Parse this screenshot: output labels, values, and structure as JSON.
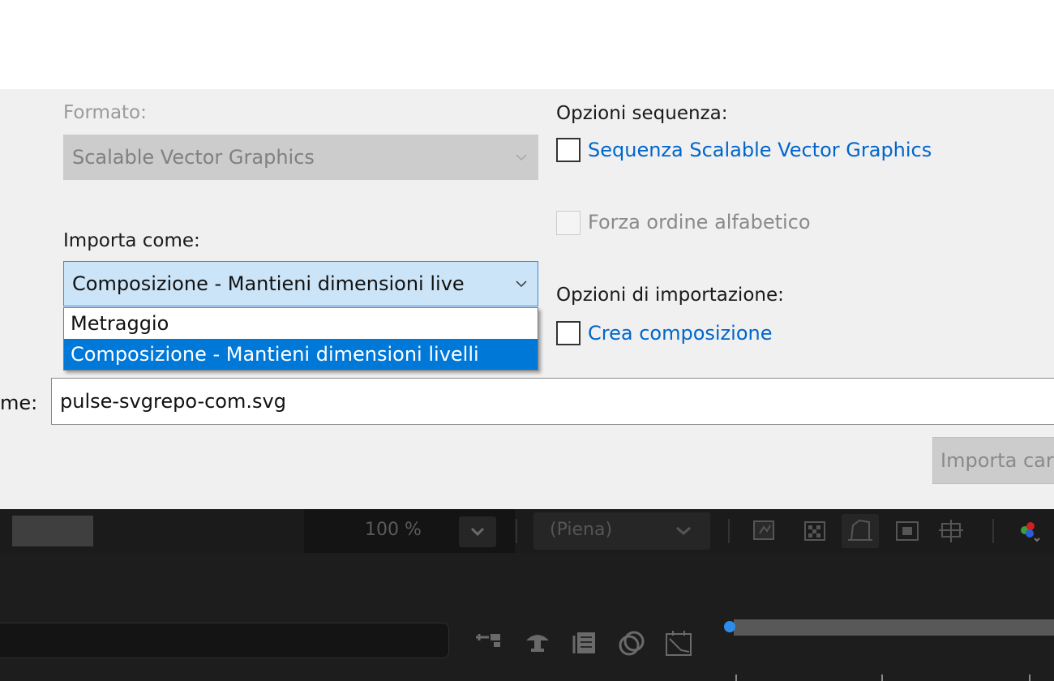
{
  "dialog": {
    "format_label": "Formato:",
    "format_value": "Scalable Vector Graphics",
    "import_as_label": "Importa come:",
    "import_as_value": "Composizione - Mantieni dimensioni live",
    "import_as_options": [
      "Metraggio",
      "Composizione - Mantieni dimensioni livelli"
    ],
    "import_as_selected_index": 1,
    "sequence_options_label": "Opzioni sequenza:",
    "sequence_checkbox_label": "Sequenza Scalable Vector Graphics",
    "sequence_checked": false,
    "alpha_order_label": "Forza ordine alfabetico",
    "alpha_order_checked": false,
    "import_options_label": "Opzioni di importazione:",
    "create_comp_label": "Crea composizione",
    "create_comp_checked": false,
    "filename_label": "me:",
    "filename_value": "pulse-svgrepo-com.svg",
    "import_button_label": "Importa car"
  },
  "viewer_toolbar": {
    "zoom": "100 %",
    "resolution": "(Piena)",
    "icons": [
      "snapshot-icon",
      "transparency-grid-icon",
      "mask-path-icon",
      "region-of-interest-icon",
      "guides-icon",
      "color-channels-icon"
    ]
  },
  "timeline": {
    "tool_icons": [
      "flowchart-icon",
      "shy-layers-icon",
      "frame-blending-icon",
      "motion-blur-icon",
      "graph-editor-icon"
    ]
  },
  "colors": {
    "dialog_bg": "#f0f0f0",
    "selection_blue": "#0078d7",
    "link_blue": "#0066cc",
    "dark_bg": "#1d1d1d",
    "timeline_marker": "#2d8ceb"
  }
}
